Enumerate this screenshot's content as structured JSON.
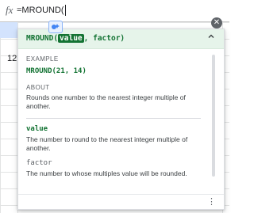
{
  "formula_bar": {
    "fx_label": "fx",
    "formula_text": "=MROUND("
  },
  "grid": {
    "cell_value": "12"
  },
  "help": {
    "function_name": "MROUND(",
    "active_param": "value",
    "rest_signature": ", factor)",
    "example_label": "EXAMPLE",
    "example_code": "MROUND(21, 14)",
    "about_label": "ABOUT",
    "about_text": "Rounds one number to the nearest integer multiple of another.",
    "params": [
      {
        "name": "value",
        "description": "The number to round to the nearest integer multiple of another."
      },
      {
        "name": "factor",
        "description": "The number to whose multiples value will be rounded."
      }
    ]
  },
  "icons": {
    "close": "close-icon",
    "collapse": "chevron-up-icon",
    "more": "more-vert-icon",
    "fx": "function-icon",
    "ai": "ai-assist-icon"
  },
  "colors": {
    "accent_green": "#137333",
    "header_green": "#e6f4ea"
  }
}
